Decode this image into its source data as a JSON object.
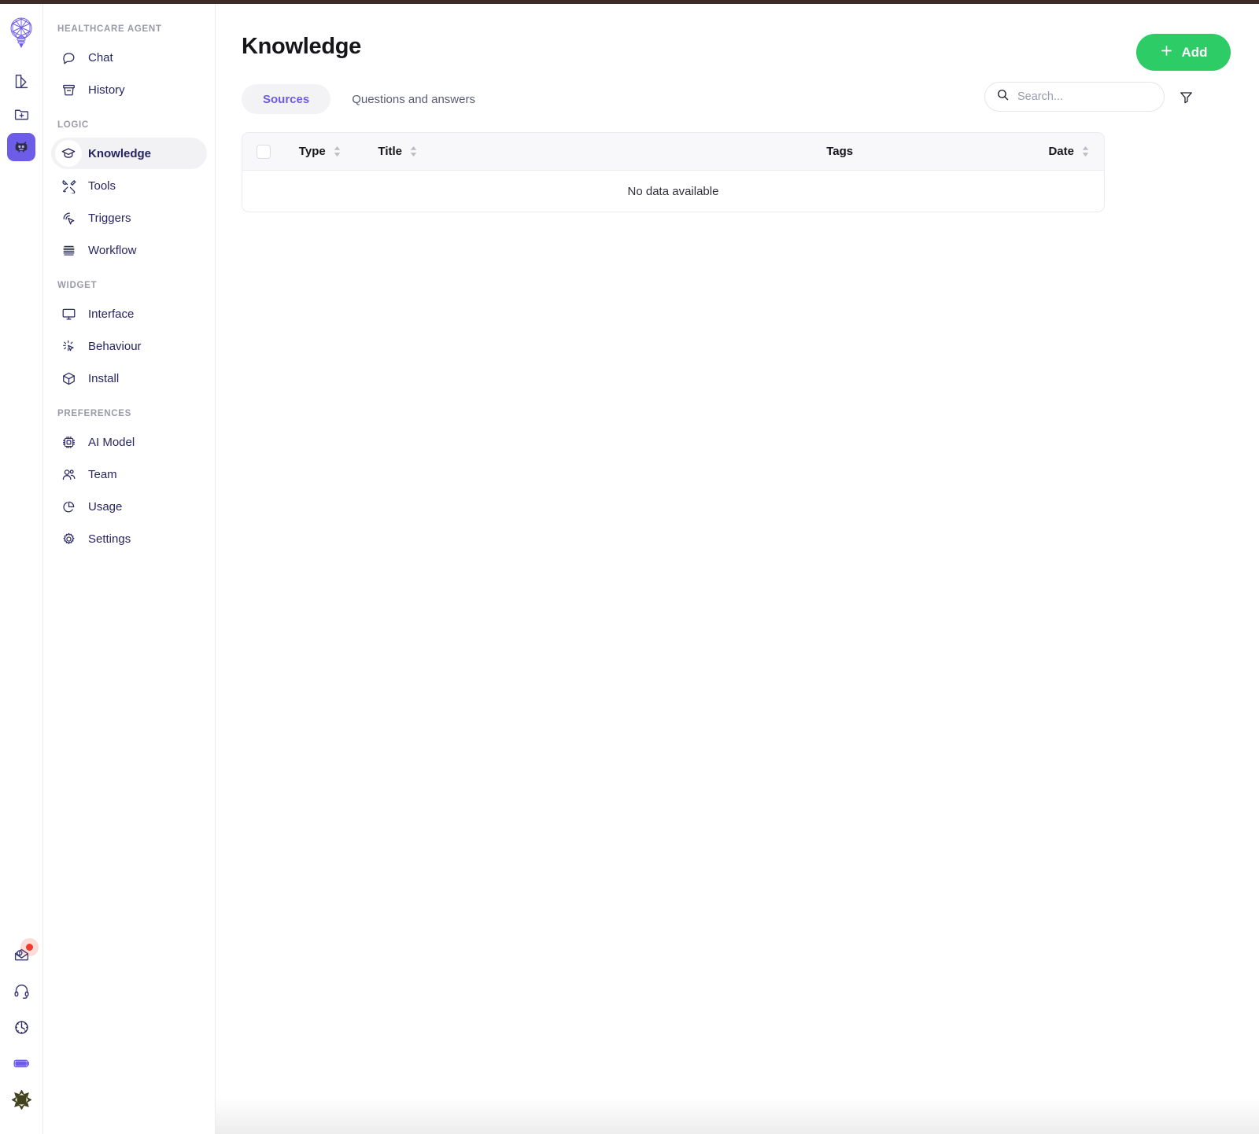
{
  "theme": {
    "accent": "#6c5ce7",
    "success": "#2ecc66",
    "nav_text": "#262663",
    "top_bar": "#3e2b26",
    "badge": "#ef3b2d",
    "header_bg": "#f8f8fa"
  },
  "rail": {
    "logo_icon": "lightbulb-network-logo",
    "items": [
      {
        "icon": "palette-icon",
        "name": "design-rail-button",
        "active": false
      },
      {
        "icon": "folder-plus-icon",
        "name": "new-folder-rail-button",
        "active": false
      },
      {
        "icon": "robot-icon",
        "name": "agent-rail-button",
        "active": true
      }
    ],
    "bottom_items": [
      {
        "icon": "notification-inbox-icon",
        "name": "notifications-rail-button",
        "badge": true
      },
      {
        "icon": "headset-icon",
        "name": "support-rail-button",
        "badge": false
      },
      {
        "icon": "clock-icon",
        "name": "history-rail-button",
        "badge": false
      },
      {
        "icon": "battery-icon",
        "name": "credits-rail-button",
        "badge": false
      },
      {
        "icon": "brightness-icon",
        "name": "theme-rail-button",
        "badge": false
      }
    ]
  },
  "sidebar": {
    "sections": [
      {
        "title": "HEALTHCARE AGENT",
        "items": [
          {
            "label": "Chat",
            "icon": "chat-bubble-icon",
            "name": "sidebar-item-chat",
            "active": false
          },
          {
            "label": "History",
            "icon": "archive-box-icon",
            "name": "sidebar-item-history",
            "active": false
          }
        ]
      },
      {
        "title": "LOGIC",
        "items": [
          {
            "label": "Knowledge",
            "icon": "graduation-cap-icon",
            "name": "sidebar-item-knowledge",
            "active": true
          },
          {
            "label": "Tools",
            "icon": "tools-icon",
            "name": "sidebar-item-tools",
            "active": false
          },
          {
            "label": "Triggers",
            "icon": "cursor-click-icon",
            "name": "sidebar-item-triggers",
            "active": false
          },
          {
            "label": "Workflow",
            "icon": "stacked-lines-icon",
            "name": "sidebar-item-workflow",
            "active": false
          }
        ]
      },
      {
        "title": "WIDGET",
        "items": [
          {
            "label": "Interface",
            "icon": "monitor-icon",
            "name": "sidebar-item-interface",
            "active": false
          },
          {
            "label": "Behaviour",
            "icon": "sparkle-cursor-icon",
            "name": "sidebar-item-behaviour",
            "active": false
          },
          {
            "label": "Install",
            "icon": "cube-icon",
            "name": "sidebar-item-install",
            "active": false
          }
        ]
      },
      {
        "title": "PREFERENCES",
        "items": [
          {
            "label": "AI Model",
            "icon": "cpu-chip-icon",
            "name": "sidebar-item-ai-model",
            "active": false
          },
          {
            "label": "Team",
            "icon": "users-icon",
            "name": "sidebar-item-team",
            "active": false
          },
          {
            "label": "Usage",
            "icon": "pie-chart-icon",
            "name": "sidebar-item-usage",
            "active": false
          },
          {
            "label": "Settings",
            "icon": "gear-icon",
            "name": "sidebar-item-settings",
            "active": false
          }
        ]
      }
    ]
  },
  "header": {
    "title": "Knowledge",
    "add_label": "Add",
    "add_icon": "plus-icon"
  },
  "tabs": [
    {
      "label": "Sources",
      "active": true
    },
    {
      "label": "Questions and answers",
      "active": false
    }
  ],
  "search": {
    "placeholder": "Search...",
    "value": "",
    "icon": "search-icon",
    "filter_icon": "filter-funnel-icon"
  },
  "table": {
    "columns": [
      {
        "label": "Type",
        "sortable": true,
        "align": "left"
      },
      {
        "label": "Title",
        "sortable": true,
        "align": "left"
      },
      {
        "label": "Tags",
        "sortable": false,
        "align": "center"
      },
      {
        "label": "Date",
        "sortable": true,
        "align": "right"
      }
    ],
    "select_all_checked": false,
    "rows": [],
    "empty_message": "No data available"
  }
}
